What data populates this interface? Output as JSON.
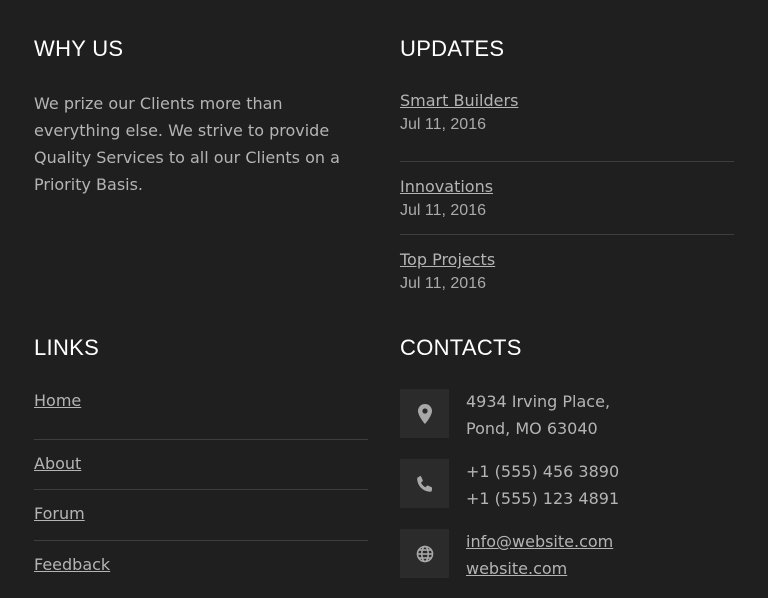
{
  "why_us": {
    "heading": "WHY US",
    "text": "We prize our Clients more than everything else. We strive to provide Quality Services to all our Clients on a Priority Basis."
  },
  "updates": {
    "heading": "UPDATES",
    "items": [
      {
        "title": "Smart Builders",
        "date": "Jul 11, 2016"
      },
      {
        "title": "Innovations",
        "date": "Jul 11, 2016"
      },
      {
        "title": "Top Projects",
        "date": "Jul 11, 2016"
      }
    ]
  },
  "links": {
    "heading": "LINKS",
    "items": [
      "Home",
      "About",
      "Forum",
      "Feedback"
    ]
  },
  "contacts": {
    "heading": "CONTACTS",
    "address_line1": "4934 Irving Place,",
    "address_line2": "Pond, MO 63040",
    "phone1": "+1 (555) 456 3890",
    "phone2": "+1 (555) 123 4891",
    "email": "info@website.com",
    "website": "website.com",
    "icons": [
      "map-pin-icon",
      "phone-icon",
      "globe-icon"
    ]
  }
}
